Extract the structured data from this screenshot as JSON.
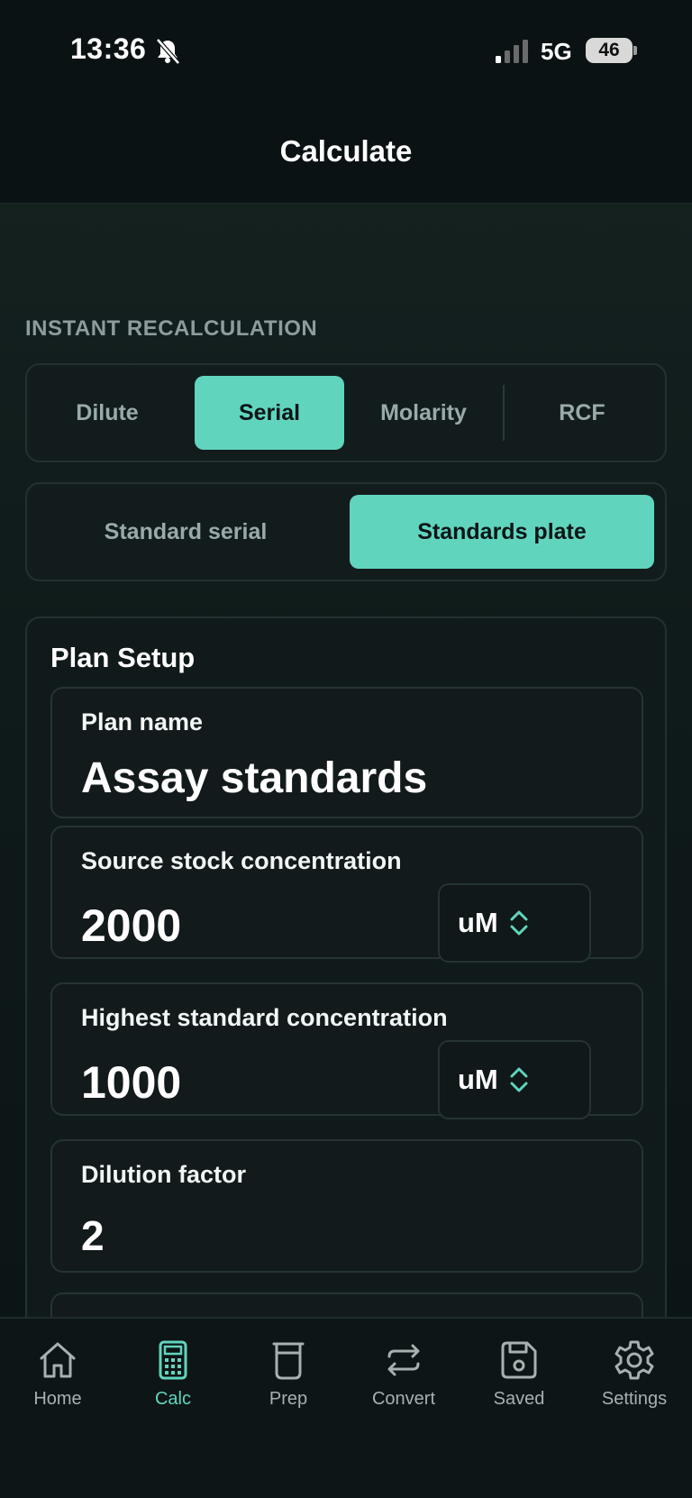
{
  "status": {
    "time": "13:36",
    "network": "5G",
    "battery": "46"
  },
  "header": {
    "title": "Calculate"
  },
  "section_label": "INSTANT RECALCULATION",
  "mode_tabs": [
    {
      "label": "Dilute",
      "active": false
    },
    {
      "label": "Serial",
      "active": true
    },
    {
      "label": "Molarity",
      "active": false
    },
    {
      "label": "RCF",
      "active": false
    }
  ],
  "sub_tabs": [
    {
      "label": "Standard serial",
      "active": false
    },
    {
      "label": "Standards plate",
      "active": true
    }
  ],
  "plan": {
    "title": "Plan Setup",
    "name_label": "Plan name",
    "name_value": "Assay standards",
    "source_label": "Source stock concentration",
    "source_value": "2000",
    "source_unit": "uM",
    "highest_label": "Highest standard concentration",
    "highest_value": "1000",
    "highest_unit": "uM",
    "factor_label": "Dilution factor",
    "factor_value": "2"
  },
  "tabbar": [
    {
      "label": "Home",
      "icon": "home-icon"
    },
    {
      "label": "Calc",
      "icon": "calculator-icon",
      "active": true
    },
    {
      "label": "Prep",
      "icon": "beaker-icon"
    },
    {
      "label": "Convert",
      "icon": "convert-arrows-icon"
    },
    {
      "label": "Saved",
      "icon": "save-icon"
    },
    {
      "label": "Settings",
      "icon": "gear-icon"
    }
  ],
  "colors": {
    "accent": "#61d4bd",
    "background": "#0b1214"
  }
}
